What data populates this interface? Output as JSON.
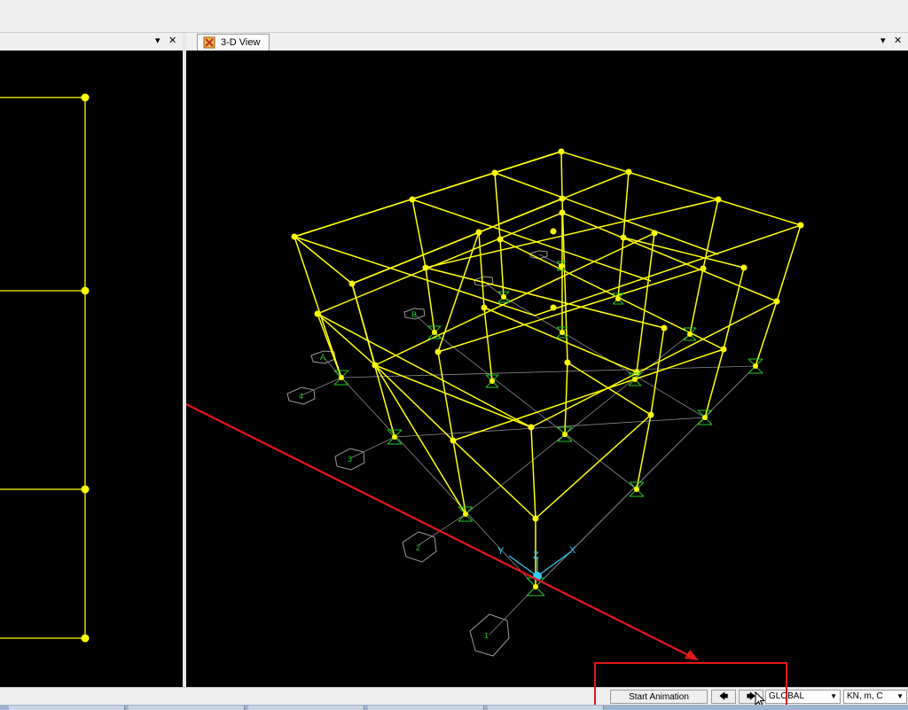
{
  "right_pane": {
    "tab_title": "3-D View"
  },
  "pane_controls": {
    "dropdown_glyph": "▾",
    "close_glyph": "✕"
  },
  "statusbar": {
    "start_animation_label": "Start Animation",
    "prev_glyph": "🡄",
    "next_glyph": "🡆",
    "coord_system": "GLOBAL",
    "units": "KN, m, C"
  },
  "colors": {
    "frame": "#ffff00",
    "support": "#22c822",
    "grid": "#9a9a9a",
    "axes": "#33ccff",
    "annotation": "#e01818"
  },
  "axes_labels": {
    "x": "X",
    "y": "Y",
    "z": "Z"
  },
  "grid_bubble_labels": [
    "1",
    "2",
    "3",
    "4",
    "A",
    "B",
    "C"
  ]
}
